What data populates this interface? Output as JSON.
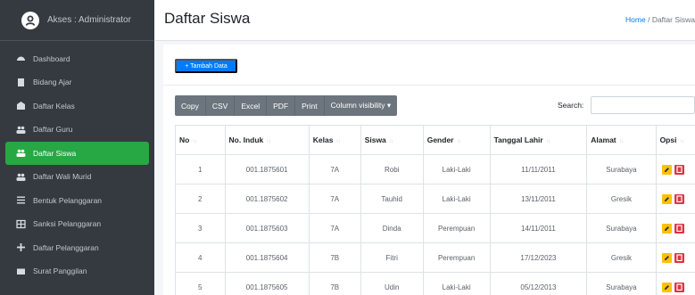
{
  "sidebar": {
    "user": "Akses : Administrator",
    "items": [
      {
        "label": "Dashboard",
        "icon": "tachometer-icon"
      },
      {
        "label": "Bidang Ajar",
        "icon": "book-icon"
      },
      {
        "label": "Daftar Kelas",
        "icon": "school-icon"
      },
      {
        "label": "Daftar Guru",
        "icon": "users-icon"
      },
      {
        "label": "Daftar Siswa",
        "icon": "users-icon",
        "active": true
      },
      {
        "label": "Daftar Wali Murid",
        "icon": "users-icon"
      },
      {
        "label": "Bentuk Pelanggaran",
        "icon": "list-icon"
      },
      {
        "label": "Sanksi Pelanggaran",
        "icon": "table-icon"
      },
      {
        "label": "Daftar Pelanggaran",
        "icon": "plus-icon"
      },
      {
        "label": "Surat Panggilan",
        "icon": "envelope-icon"
      }
    ]
  },
  "header": {
    "title": "Daftar Siswa",
    "breadcrumb_home": "Home",
    "breadcrumb_sep": "/",
    "breadcrumb_current": "Daftar Siswa"
  },
  "toolbar": {
    "add_label": "+ Tambah Data",
    "export_buttons": [
      "Copy",
      "CSV",
      "Excel",
      "PDF",
      "Print",
      "Column visibility ▾"
    ],
    "search_label": "Search:"
  },
  "table": {
    "columns": [
      "No",
      "No. Induk",
      "Kelas",
      "Siswa",
      "Gender",
      "Tanggal Lahir",
      "Alamat",
      "Opsi"
    ],
    "rows": [
      [
        "1",
        "001.1875601",
        "7A",
        "Robi",
        "Laki-Laki",
        "11/11/2011",
        "Surabaya"
      ],
      [
        "2",
        "001.1875602",
        "7A",
        "Tauhid",
        "Laki-Laki",
        "13/11/2011",
        "Gresik"
      ],
      [
        "3",
        "001.1875603",
        "7A",
        "Dinda",
        "Perempuan",
        "14/11/2011",
        "Surabaya"
      ],
      [
        "4",
        "001.1875604",
        "7B",
        "Fitri",
        "Perempuan",
        "17/12/2023",
        "Gresik"
      ],
      [
        "5",
        "001.1875605",
        "7B",
        "Udin",
        "Laki-Laki",
        "05/12/2013",
        "Surabaya"
      ]
    ]
  },
  "colors": {
    "sidebar_bg": "#343a40",
    "active": "#28a745",
    "primary": "#007bff",
    "warning": "#ffc107",
    "danger": "#dc3545"
  }
}
